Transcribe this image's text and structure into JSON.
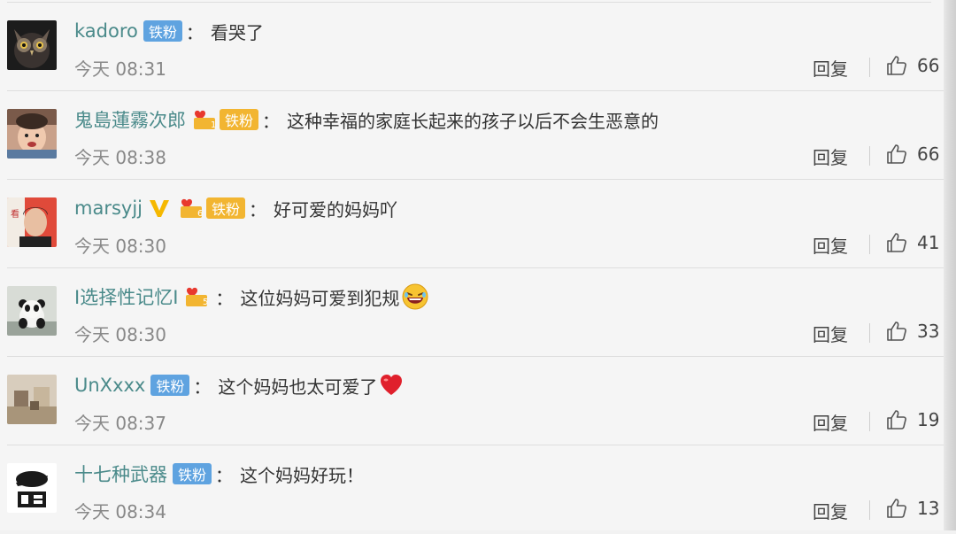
{
  "comments": [
    {
      "username": "kadoro",
      "badge": "铁粉",
      "badge_type": "blue",
      "content": "看哭了",
      "time": "今天 08:31",
      "reply": "回复",
      "likes": "66"
    },
    {
      "username": "鬼島蓮霧次郎",
      "badge": "铁粉",
      "badge_type": "gold",
      "crown_level": "1",
      "content": "这种幸福的家庭长起来的孩子以后不会生恶意的",
      "time": "今天 08:38",
      "reply": "回复",
      "likes": "66"
    },
    {
      "username": "marsyjj",
      "verified": true,
      "badge": "铁粉",
      "badge_type": "gold",
      "crown_level": "6",
      "content": "好可爱的妈妈吖",
      "time": "今天 08:30",
      "reply": "回复",
      "likes": "41"
    },
    {
      "username": "I选择性记忆I",
      "crown_level": "5",
      "content": "这位妈妈可爱到犯规",
      "emoji": "laughing-emoji",
      "time": "今天 08:30",
      "reply": "回复",
      "likes": "33"
    },
    {
      "username": "UnXxxx",
      "badge": "铁粉",
      "badge_type": "blue",
      "content": "这个妈妈也太可爱了",
      "emoji": "heart-emoji",
      "time": "今天 08:37",
      "reply": "回复",
      "likes": "19"
    },
    {
      "username": "十七种武器",
      "badge": "铁粉",
      "badge_type": "blue",
      "content": "这个妈妈好玩！",
      "time": "今天 08:34",
      "reply": "回复",
      "likes": "13"
    }
  ],
  "separator": "：",
  "colors": {
    "username": "#4a8a8a",
    "badge_blue": "#5fa3e0",
    "badge_gold": "#f2b531",
    "verified": "#f5b800",
    "time": "#888888"
  }
}
